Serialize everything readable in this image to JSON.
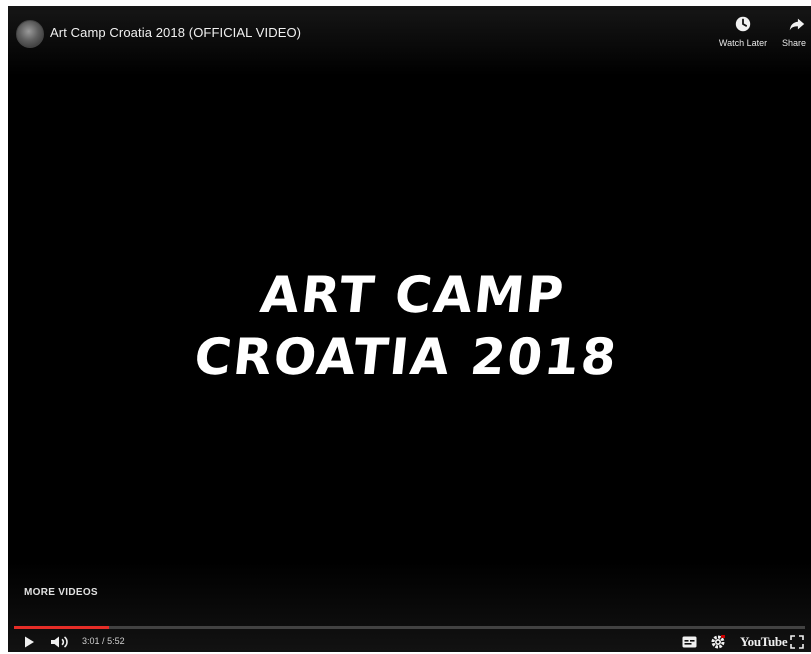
{
  "player": {
    "title": "Art Camp Croatia 2018 (OFFICIAL VIDEO)",
    "actions": {
      "watch_later_label": "Watch Later",
      "share_label": "Share"
    },
    "overlay_title_lines": [
      "ART CAMP",
      "CROATIA 2018"
    ],
    "more_videos_label": "MORE VIDEOS",
    "time": {
      "current": "3:01",
      "separator": "/",
      "duration": "5:52"
    },
    "progress_fraction": 0.12,
    "logo_text": "YouTube"
  },
  "icons": {
    "avatar": "channel-avatar",
    "watch_later": "clock-icon",
    "share": "share-arrow-icon",
    "play": "play-icon",
    "volume": "volume-icon",
    "subtitles": "subtitles-icon",
    "settings": "settings-gear-icon",
    "fullscreen": "fullscreen-icon"
  },
  "colors": {
    "background": "#000000",
    "progress": "#e52d27",
    "text": "#ffffff"
  }
}
